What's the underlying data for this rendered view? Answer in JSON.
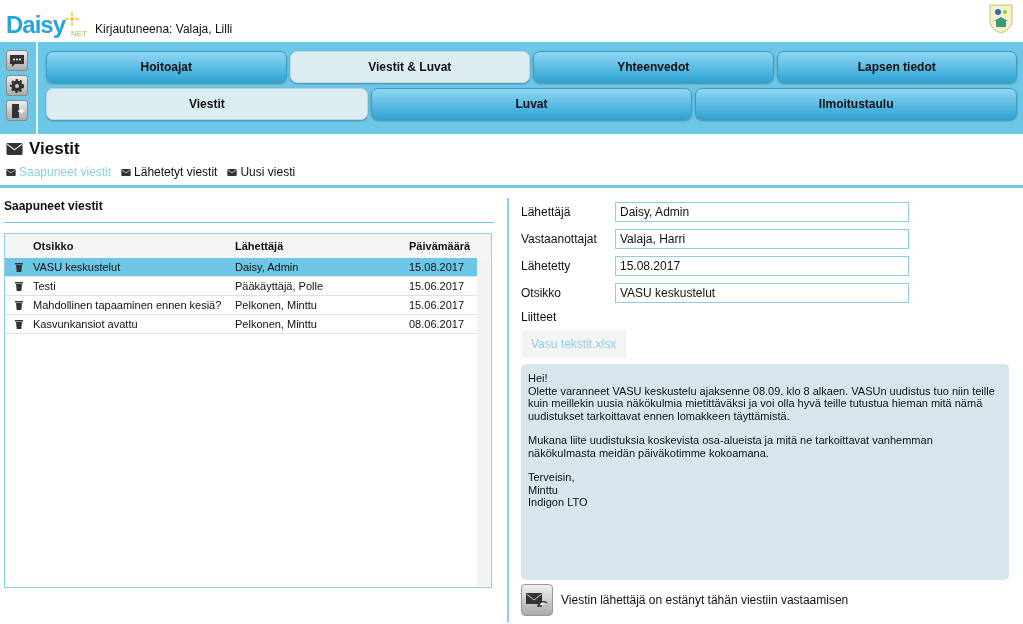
{
  "header": {
    "logo": "Daisy",
    "logo_sub": "NET",
    "user_label": "Kirjautuneena: Valaja, Lilli"
  },
  "main_tabs": [
    {
      "label": "Hoitoajat",
      "selected": false
    },
    {
      "label": "Viestit & Luvat",
      "selected": true
    },
    {
      "label": "Yhteenvedot",
      "selected": false
    },
    {
      "label": "Lapsen tiedot",
      "selected": false
    }
  ],
  "sub_tabs": [
    {
      "label": "Viestit",
      "selected": true
    },
    {
      "label": "Luvat",
      "selected": false
    },
    {
      "label": "Ilmoitustaulu",
      "selected": false
    }
  ],
  "page_title": "Viestit",
  "sub_nav": [
    {
      "label": "Saapuneet viestit",
      "selected": true
    },
    {
      "label": "Lähetetyt viestit",
      "selected": false
    },
    {
      "label": "Uusi viesti",
      "selected": false
    }
  ],
  "inbox": {
    "title": "Saapuneet viestit",
    "columns": [
      "Otsikko",
      "Lähettäjä",
      "Päivämäärä"
    ],
    "rows": [
      {
        "subject": "VASU keskustelut",
        "sender": "Daisy, Admin",
        "date": "15.08.2017",
        "selected": true
      },
      {
        "subject": "Testi",
        "sender": "Pääkäyttäjä, Polle",
        "date": "15.06.2017",
        "selected": false
      },
      {
        "subject": "Mahdollinen tapaaminen ennen kesiä?",
        "sender": "Pelkonen, Minttu",
        "date": "15.06.2017",
        "selected": false
      },
      {
        "subject": "Kasvunkansiot avattu",
        "sender": "Pelkonen, Minttu",
        "date": "08.06.2017",
        "selected": false
      }
    ]
  },
  "message": {
    "fields": [
      {
        "label": "Lähettäjä",
        "value": "Daisy, Admin"
      },
      {
        "label": "Vastaanottajat",
        "value": "Valaja, Harri"
      },
      {
        "label": "Lähetetty",
        "value": "15.08.2017"
      },
      {
        "label": "Otsikko",
        "value": "VASU keskustelut"
      }
    ],
    "attachments_label": "Liitteet",
    "attachments": [
      "Vasu tekstit.xlsx"
    ],
    "body": [
      "Hei!\nOlette varanneet VASU keskustelu ajaksenne 08.09. klo 8 alkaen. VASUn uudistus tuo niin teille kuin meillekin uusia näkökulmia mietittäväksi ja voi olla hyvä teille tutustua hieman mitä nämä uudistukset tarkoittavat ennen lomakkeen täyttämistä.",
      "Mukana liite uudistuksia koskevista osa-alueista ja mitä ne tarkoittavat vanhemman näkökulmasta meidän päiväkotimme kokoamana.",
      "Terveisin,\nMinttu\nIndigon LTO"
    ],
    "reply_note": "Viestin lähettäjä on estänyt tähän viestiin vastaamisen"
  }
}
